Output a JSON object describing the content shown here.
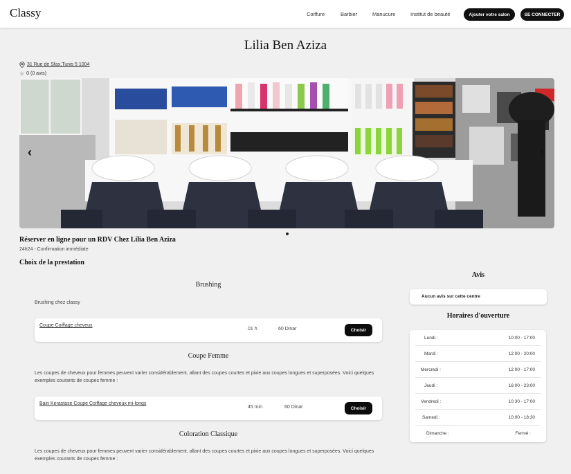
{
  "header": {
    "logo": "Classy",
    "nav": [
      "Coiffure",
      "Barbier",
      "Manucure",
      "Institut de beauté"
    ],
    "add_salon_label": "Ajouter votre salon",
    "login_label": "SE CONNECTER"
  },
  "salon": {
    "name": "Lilia Ben Aziza",
    "address": "31 Rue de Sfax,Tunis 5 1004",
    "rating": "0 (0 avis)"
  },
  "booking": {
    "title": "Réserver en ligne pour un RDV Chez Lilia Ben Aziza",
    "subtitle": "24h24 - Confirmation immédiate",
    "choice_title": "Choix de la prestation"
  },
  "categories": [
    {
      "title": "Brushing",
      "description": "Brushing chez classy",
      "services": [
        {
          "name": "Coupe Coiffage cheveux",
          "duration": "01 h",
          "price": "60 Dinar",
          "button": "Choisir"
        }
      ]
    },
    {
      "title": "Coupe Femme",
      "description": "Les coupes de cheveux pour femmes peuvent varier considérablement, allant des coupes courtes et pixie aux coupes longues et superposées. Voici quelques exemples courants de coupes femme :",
      "services": [
        {
          "name": "Bain Kerastase Coupe Coiffage cheveux mi-longs",
          "duration": "45 min",
          "price": "60 Dinar",
          "button": "Choisir"
        }
      ]
    },
    {
      "title": "Coloration Classique",
      "description": "Les coupes de cheveux pour femmes peuvent varier considérablement, allant des coupes courtes et pixie aux coupes longues et superposées. Voici quelques exemples courants de coupes femme :",
      "services": []
    }
  ],
  "reviews": {
    "title": "Avis",
    "empty_text": "Aucun avis sur cette centre"
  },
  "hours": {
    "title": "Horaires d'ouverture",
    "rows": [
      {
        "day": "Lundi :",
        "time": "10:00 - 17:00"
      },
      {
        "day": "Mardi :",
        "time": "12:00 - 20:00"
      },
      {
        "day": "Mercredi :",
        "time": "12:00 - 17:00"
      },
      {
        "day": "Jeudi :",
        "time": "16:00 - 23:00"
      },
      {
        "day": "Vendredi :",
        "time": "10:30 - 17:00"
      },
      {
        "day": "Samedi :",
        "time": "10:00 - 18:30"
      },
      {
        "day": "Dimanche :",
        "time": "Fermé :"
      }
    ]
  },
  "carousel": {
    "prev_icon": "chevron-left-icon",
    "next_icon": "chevron-right-icon",
    "current_slide": 1
  }
}
